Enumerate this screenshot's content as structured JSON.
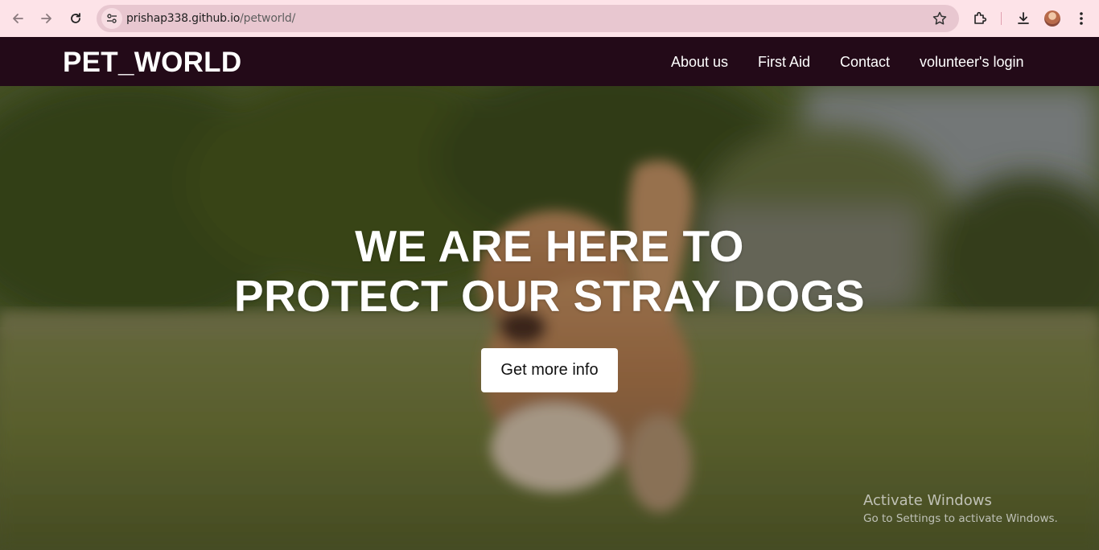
{
  "browser": {
    "url_domain": "prishap338.github.io",
    "url_path": "/petworld/",
    "icons": [
      "back-arrow-icon",
      "forward-arrow-icon",
      "reload-icon",
      "site-settings-icon",
      "bookmark-star-icon",
      "extensions-icon",
      "download-icon",
      "profile-avatar",
      "more-menu-icon"
    ]
  },
  "header": {
    "logo": "PET_WORLD",
    "nav": [
      {
        "label": "About us"
      },
      {
        "label": "First Aid"
      },
      {
        "label": "Contact"
      },
      {
        "label": "volunteer's login"
      }
    ],
    "background": "#230a18"
  },
  "hero": {
    "title_line1": "WE ARE HERE TO",
    "title_line2": "PROTECT OUR STRAY DOGS",
    "cta_label": "Get more info"
  },
  "os_watermark": {
    "line1": "Activate Windows",
    "line2": "Go to Settings to activate Windows."
  }
}
